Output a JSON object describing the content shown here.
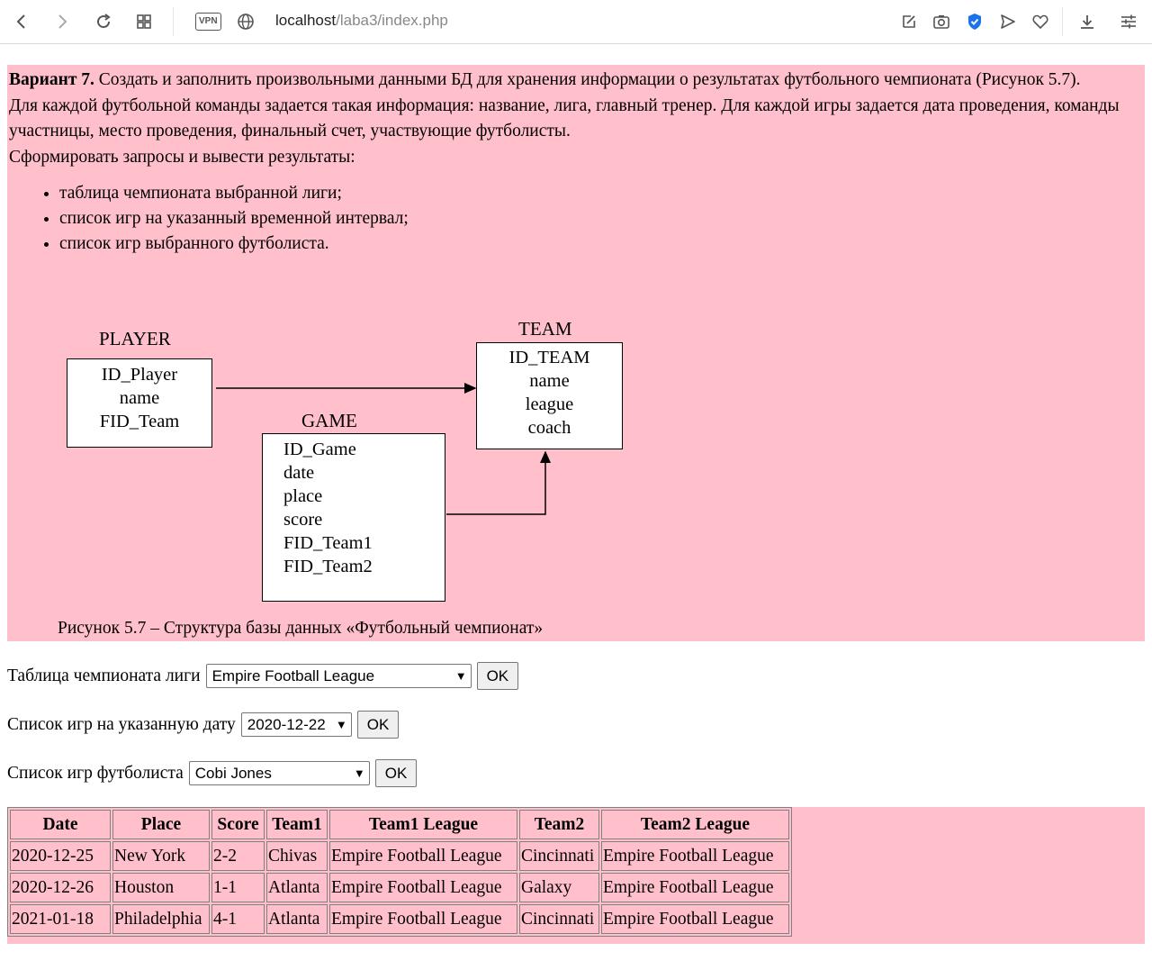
{
  "browser": {
    "vpn_label": "VPN",
    "url_host": "localhost",
    "url_path": "/laba3/index.php"
  },
  "task": {
    "variant_label": "Вариант 7.",
    "intro": " Создать и заполнить произвольными данными БД для хранения информации о результатах футбольного чемпионата (Рисунок 5.7).",
    "details": "Для каждой футбольной команды задается такая информация: название, лига, главный тренер. Для каждой игры задается дата проведения, команды участницы, место проведения, финальный счет, участвующие футболисты.",
    "queries_intro": "Сформировать запросы и вывести результаты:",
    "queries": [
      "таблица чемпионата выбранной лиги;",
      "список игр на указанный временной интервал;",
      "список игр выбранного футболиста."
    ]
  },
  "diagram": {
    "player": {
      "title": "PLAYER",
      "fields": [
        "ID_Player",
        "name",
        "FID_Team"
      ]
    },
    "team": {
      "title": "TEAM",
      "fields": [
        "ID_TEAM",
        "name",
        "league",
        "coach"
      ]
    },
    "game": {
      "title": "GAME",
      "fields": [
        "ID_Game",
        "date",
        "place",
        "score",
        "FID_Team1",
        "FID_Team2"
      ]
    },
    "caption": "Рисунок 5.7 – Структура базы данных «Футбольный чемпионат»"
  },
  "forms": {
    "league": {
      "label": "Таблица чемпионата лиги",
      "selected": "Empire Football League",
      "button": "OK"
    },
    "date": {
      "label": "Список игр на указанную дату",
      "selected": "2020-12-22",
      "button": "OK"
    },
    "player": {
      "label": "Список игр футболиста",
      "selected": "Cobi Jones",
      "button": "OK"
    }
  },
  "results": {
    "headers": [
      "Date",
      "Place",
      "Score",
      "Team1",
      "Team1 League",
      "Team2",
      "Team2 League"
    ],
    "rows": [
      [
        "2020-12-25",
        "New York",
        "2-2",
        "Chivas",
        "Empire Football League",
        "Cincinnati",
        "Empire Football League"
      ],
      [
        "2020-12-26",
        "Houston",
        "1-1",
        "Atlanta",
        "Empire Football League",
        "Galaxy",
        "Empire Football League"
      ],
      [
        "2021-01-18",
        "Philadelphia",
        "4-1",
        "Atlanta",
        "Empire Football League",
        "Cincinnati",
        "Empire Football League"
      ]
    ]
  },
  "icons": {
    "back": "arrow-left-icon",
    "forward": "arrow-right-icon",
    "reload": "reload-icon",
    "tabs": "grid-icon",
    "globe": "globe-icon",
    "edit": "edit-icon",
    "camera": "camera-icon",
    "shield": "shield-check-icon",
    "send": "send-icon",
    "heart": "heart-icon",
    "download": "download-icon",
    "menu": "settings-sliders-icon"
  },
  "colors": {
    "page_highlight": "#ffc0cb",
    "shield_accent": "#1a73e8"
  }
}
